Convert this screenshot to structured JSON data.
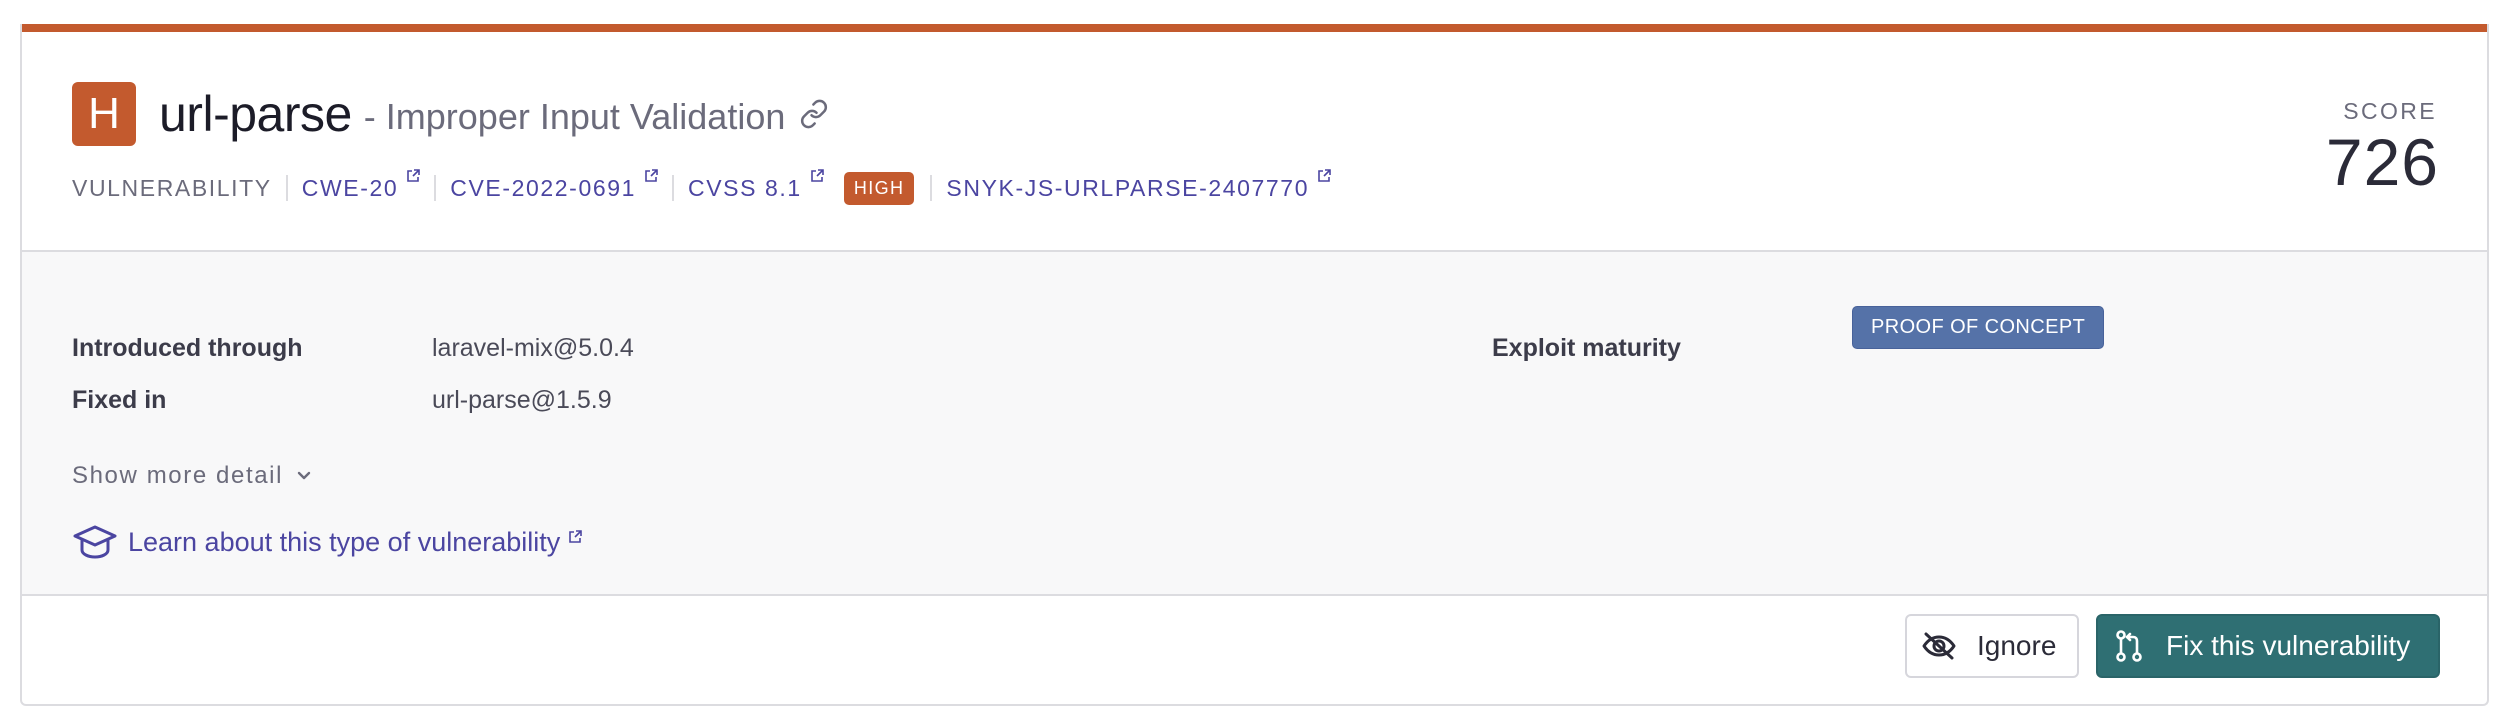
{
  "severity": {
    "letter": "H",
    "color": "#c35a2e"
  },
  "title": {
    "package": "url-parse",
    "vulnerability": "- Improper Input Validation",
    "link_icon": "link-icon"
  },
  "meta": {
    "type": "VULNERABILITY",
    "cwe": "CWE-20",
    "cve": "CVE-2022-0691",
    "cvss": "CVSS 8.1",
    "severity_tag": "HIGH",
    "snyk_id": "SNYK-JS-URLPARSE-2407770",
    "external_icon": "external-link-icon"
  },
  "score": {
    "label": "SCORE",
    "value": "726"
  },
  "details": {
    "introduced_label": "Introduced through",
    "introduced_value": "laravel-mix@5.0.4",
    "fixed_label": "Fixed in",
    "fixed_value": "url-parse@1.5.9",
    "exploit_label": "Exploit maturity",
    "exploit_value": "PROOF OF CONCEPT",
    "show_more": "Show more detail",
    "learn": "Learn about this type of vulnerability"
  },
  "actions": {
    "ignore": "Ignore",
    "fix": "Fix this vulnerability"
  },
  "colors": {
    "accent": "#c35a2e",
    "link": "#4b45a1",
    "exploit_badge": "#5572a8",
    "fix_button": "#2f6f73"
  }
}
